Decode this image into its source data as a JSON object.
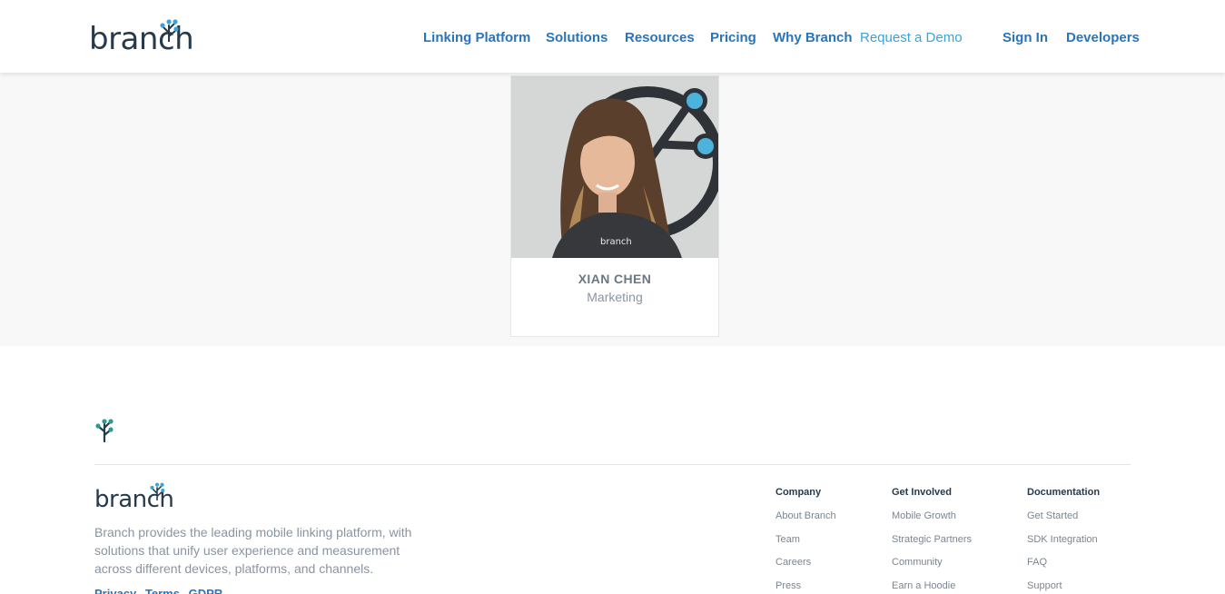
{
  "header": {
    "logo_text": "branch",
    "nav": {
      "linking_platform": "Linking Platform",
      "solutions": "Solutions",
      "resources": "Resources",
      "pricing": "Pricing",
      "why_branch": "Why Branch",
      "request_demo": "Request a Demo",
      "sign_in": "Sign In",
      "developers": "Developers"
    }
  },
  "profile": {
    "name": "XIAN CHEN",
    "role": "Marketing"
  },
  "footer": {
    "logo_text": "branch",
    "description": "Branch provides the leading mobile linking platform, with solutions that unify user experience and measurement across different devices, platforms, and channels.",
    "legal": {
      "privacy": "Privacy",
      "terms": "Terms",
      "gdpr": "GDPR"
    },
    "columns": [
      {
        "heading": "Company",
        "items": [
          "About Branch",
          "Team",
          "Careers",
          "Press"
        ]
      },
      {
        "heading": "Get Involved",
        "items": [
          "Mobile Growth",
          "Strategic Partners",
          "Community",
          "Earn a Hoodie"
        ]
      },
      {
        "heading": "Documentation",
        "items": [
          "Get Started",
          "SDK Integration",
          "FAQ",
          "Support"
        ]
      }
    ]
  },
  "colors": {
    "brand_navy": "#263a4c",
    "link_blue": "#2a74b9",
    "accent_cyan": "#3aa3d8"
  }
}
